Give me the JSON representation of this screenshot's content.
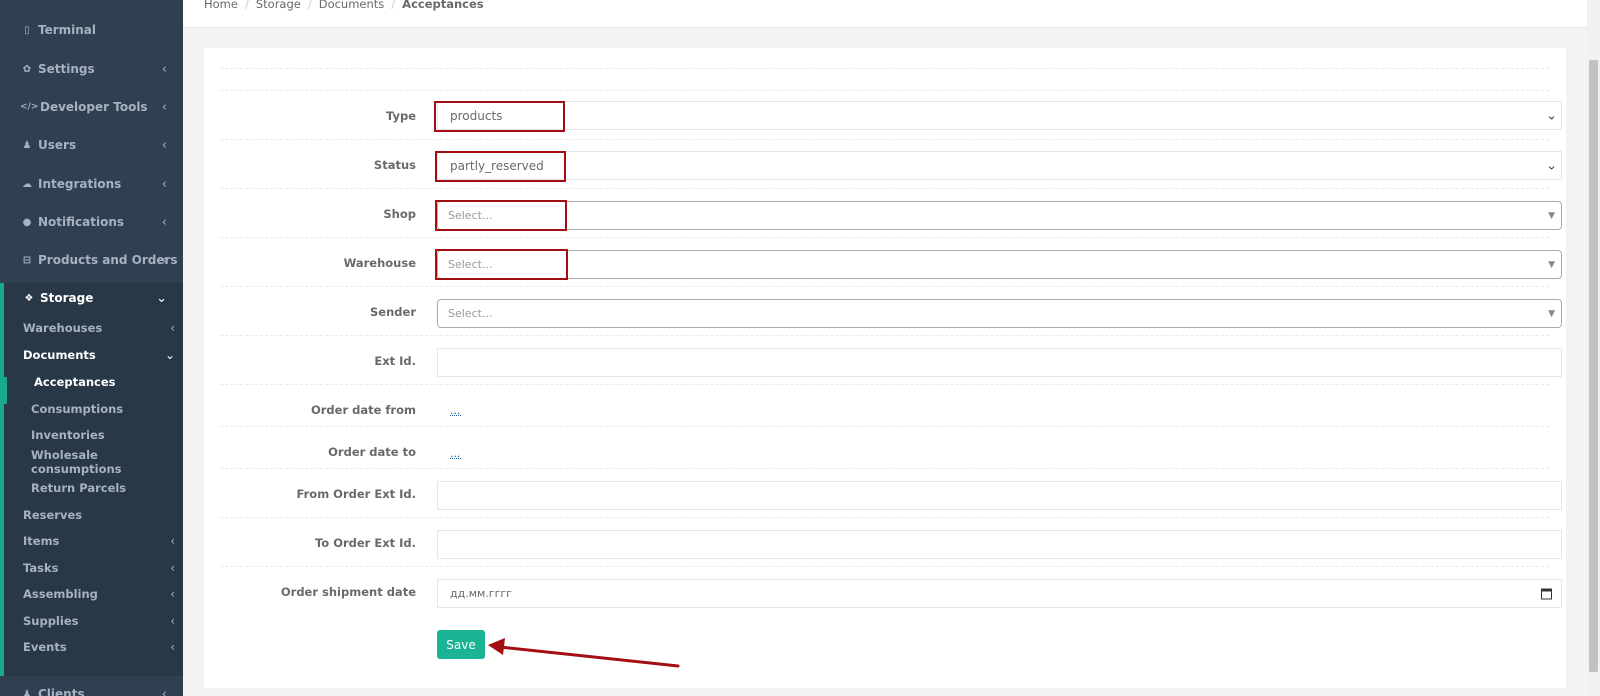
{
  "sidebar": {
    "top_items": [
      {
        "label": "Terminal",
        "icon": "tablet-icon",
        "glyph": "▯",
        "has_chevron": false
      },
      {
        "label": "Settings",
        "icon": "gear-icon",
        "glyph": "✿",
        "has_chevron": true
      },
      {
        "label": "Developer Tools",
        "icon": "code-icon",
        "glyph": "</>",
        "has_chevron": true
      },
      {
        "label": "Users",
        "icon": "user-icon",
        "glyph": "♟",
        "has_chevron": true
      },
      {
        "label": "Integrations",
        "icon": "cloud-icon",
        "glyph": "☁",
        "has_chevron": true
      },
      {
        "label": "Notifications",
        "icon": "info-icon",
        "glyph": "●",
        "has_chevron": true
      },
      {
        "label": "Products and Orders",
        "icon": "cart-icon",
        "glyph": "⊟",
        "has_chevron": true
      }
    ],
    "storage": {
      "label": "Storage",
      "icon": "cubes-icon",
      "glyph": "❖"
    },
    "storage_items": [
      {
        "label": "Warehouses",
        "level": 1,
        "chevron": "‹"
      },
      {
        "label": "Documents",
        "level": 1,
        "chevron": "⌄",
        "active_parent": true
      },
      {
        "label": "Acceptances",
        "level": 2,
        "active": true
      },
      {
        "label": "Consumptions",
        "level": 2
      },
      {
        "label": "Inventories",
        "level": 2
      },
      {
        "label": "Wholesale consumptions",
        "level": 2
      },
      {
        "label": "Return Parcels",
        "level": 2
      },
      {
        "label": "Reserves",
        "level": 1
      },
      {
        "label": "Items",
        "level": 1,
        "chevron": "‹"
      },
      {
        "label": "Tasks",
        "level": 1,
        "chevron": "‹"
      },
      {
        "label": "Assembling",
        "level": 1,
        "chevron": "‹"
      },
      {
        "label": "Supplies",
        "level": 1,
        "chevron": "‹"
      },
      {
        "label": "Events",
        "level": 1,
        "chevron": "‹"
      }
    ],
    "bottom_item": {
      "label": "Clients",
      "icon": "users-icon",
      "glyph": "♟"
    }
  },
  "breadcrumb": {
    "items": [
      "Home",
      "Storage",
      "Documents"
    ],
    "current": "Acceptances"
  },
  "form": {
    "type": {
      "label": "Type",
      "value": "products"
    },
    "status": {
      "label": "Status",
      "value": "partly_reserved"
    },
    "shop": {
      "label": "Shop",
      "placeholder": "Select..."
    },
    "warehouse": {
      "label": "Warehouse",
      "placeholder": "Select..."
    },
    "sender": {
      "label": "Sender",
      "placeholder": "Select..."
    },
    "ext_id": {
      "label": "Ext Id.",
      "value": ""
    },
    "order_date_from": {
      "label": "Order date from",
      "value": "..."
    },
    "order_date_to": {
      "label": "Order date to",
      "value": "..."
    },
    "from_order_ext_id": {
      "label": "From Order Ext Id.",
      "value": ""
    },
    "to_order_ext_id": {
      "label": "To Order Ext Id.",
      "value": ""
    },
    "order_shipment_date": {
      "label": "Order shipment date",
      "placeholder": "дд.мм.гггг"
    },
    "save_label": "Save"
  },
  "colors": {
    "sidebar_bg": "#2f4050",
    "accent": "#1ab394",
    "highlight": "#a20e12"
  }
}
